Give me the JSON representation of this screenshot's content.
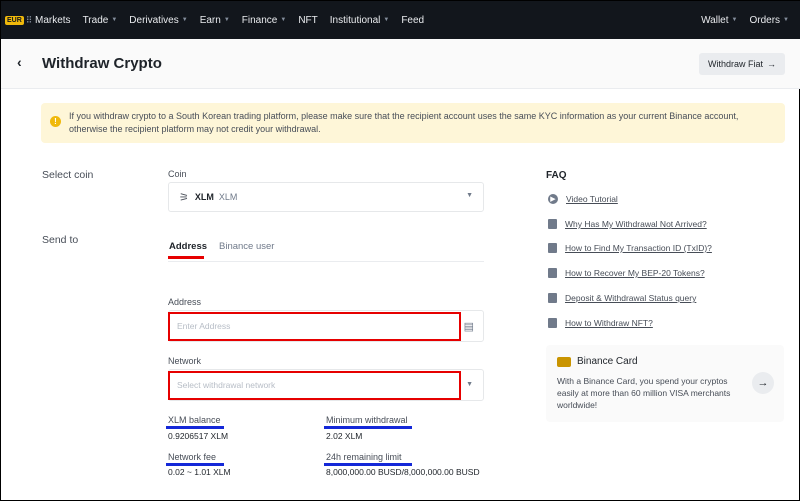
{
  "nav": {
    "badge": "EUR",
    "grid_icon": "grid-icon",
    "items": [
      {
        "label": "Markets",
        "has_menu": false
      },
      {
        "label": "Trade",
        "has_menu": true
      },
      {
        "label": "Derivatives",
        "has_menu": true
      },
      {
        "label": "Earn",
        "has_menu": true
      },
      {
        "label": "Finance",
        "has_menu": true
      },
      {
        "label": "NFT",
        "has_menu": false
      },
      {
        "label": "Institutional",
        "has_menu": true
      },
      {
        "label": "Feed",
        "has_menu": false
      }
    ],
    "right": [
      {
        "label": "Wallet",
        "has_menu": true
      },
      {
        "label": "Orders",
        "has_menu": true
      }
    ],
    "caret": "▼"
  },
  "header": {
    "back_icon": "‹",
    "title": "Withdraw Crypto",
    "fiat_button": "Withdraw Fiat",
    "fiat_arrow": "→"
  },
  "banner": {
    "icon": "!",
    "text": "If you withdraw crypto to a South Korean trading platform, please make sure that the recipient account uses the same KYC information as your current Binance account, otherwise the recipient platform may not credit your withdrawal."
  },
  "form": {
    "select_coin_label": "Select coin",
    "send_to_label": "Send to",
    "coin_label": "Coin",
    "coin_icon": "⚞",
    "coin_symbol": "XLM",
    "coin_name": "XLM",
    "dropdown_icon": "▼",
    "tabs": [
      "Address",
      "Binance user"
    ],
    "address_label": "Address",
    "address_placeholder": "Enter Address",
    "paste_icon": "▤",
    "network_label": "Network",
    "network_placeholder": "Select withdrawal network"
  },
  "info": {
    "balance_label": "XLM balance",
    "balance_value": "0.9206517 XLM",
    "min_label": "Minimum withdrawal",
    "min_value": "2.02 XLM",
    "fee_label": "Network fee",
    "fee_value": "0.02 ~ 1.01 XLM",
    "limit_label": "24h remaining limit",
    "limit_value": "8,000,000.00 BUSD/8,000,000.00 BUSD"
  },
  "faq": {
    "title": "FAQ",
    "items": [
      {
        "label": "Video Tutorial",
        "icon": "play-icon"
      },
      {
        "label": "Why Has My Withdrawal Not Arrived?",
        "icon": "document-icon"
      },
      {
        "label": "How to Find My Transaction ID (TxID)?",
        "icon": "document-icon"
      },
      {
        "label": "How to Recover My BEP-20 Tokens?",
        "icon": "document-icon"
      },
      {
        "label": "Deposit & Withdrawal Status query",
        "icon": "document-icon"
      },
      {
        "label": "How to Withdraw NFT?",
        "icon": "document-icon"
      }
    ]
  },
  "card": {
    "title": "Binance Card",
    "text": "With a Binance Card, you spend your cryptos easily at more than 60 million VISA merchants worldwide!",
    "arrow": "→"
  },
  "colors": {
    "annotation_red": "#e60000",
    "annotation_blue": "#1428d8",
    "brand_yellow": "#f0b90b"
  }
}
